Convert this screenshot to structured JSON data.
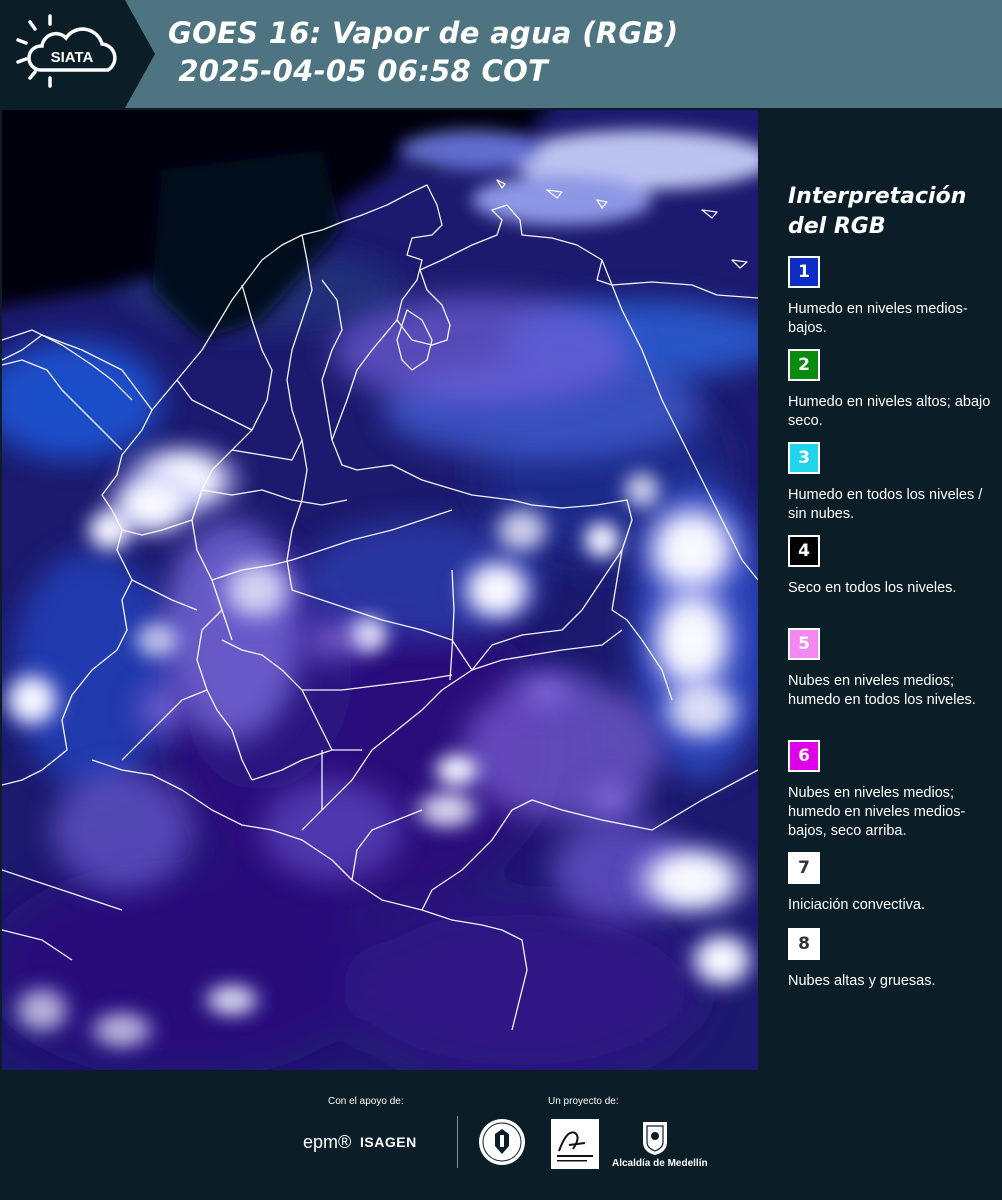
{
  "header": {
    "logo_text": "SIATA",
    "title_line1": "GOES 16: Vapor de agua (RGB)",
    "title_line2": " 2025-04-05 06:58 COT",
    "background_color": "#4e7482"
  },
  "legend": {
    "title": "Interpretación del RGB",
    "items": [
      {
        "number": "1",
        "color": "#0b2ec4",
        "description": "Humedo en niveles medios-bajos."
      },
      {
        "number": "2",
        "color": "#0a8a10",
        "description": "Humedo en niveles altos; abajo seco."
      },
      {
        "number": "3",
        "color": "#22d3ec",
        "description": "Humedo en todos los niveles / sin nubes."
      },
      {
        "number": "4",
        "color": "#000000",
        "description": "Seco en todos los niveles."
      },
      {
        "number": "5",
        "color": "#f487f2",
        "description": "Nubes en niveles medios; humedo en todos los niveles."
      },
      {
        "number": "6",
        "color": "#e000e8",
        "description": "Nubes en niveles medios; humedo en niveles medios-bajos, seco arriba."
      },
      {
        "number": "7",
        "color": "#ffffff",
        "description": "Iniciación convectiva."
      },
      {
        "number": "8",
        "color": "#ffffff",
        "description": "Nubes altas y gruesas."
      }
    ]
  },
  "footer": {
    "support_label": "Con el apoyo de:",
    "project_label": "Un proyecto de:",
    "sponsor_epm": "epm®",
    "sponsor_isagen": "ISAGEN",
    "alcaldia_label": "Alcaldía de Medellín"
  },
  "colors": {
    "page_background": "#0b1d26",
    "map_base": "#1a1666",
    "border_lines": "#ffffff"
  }
}
